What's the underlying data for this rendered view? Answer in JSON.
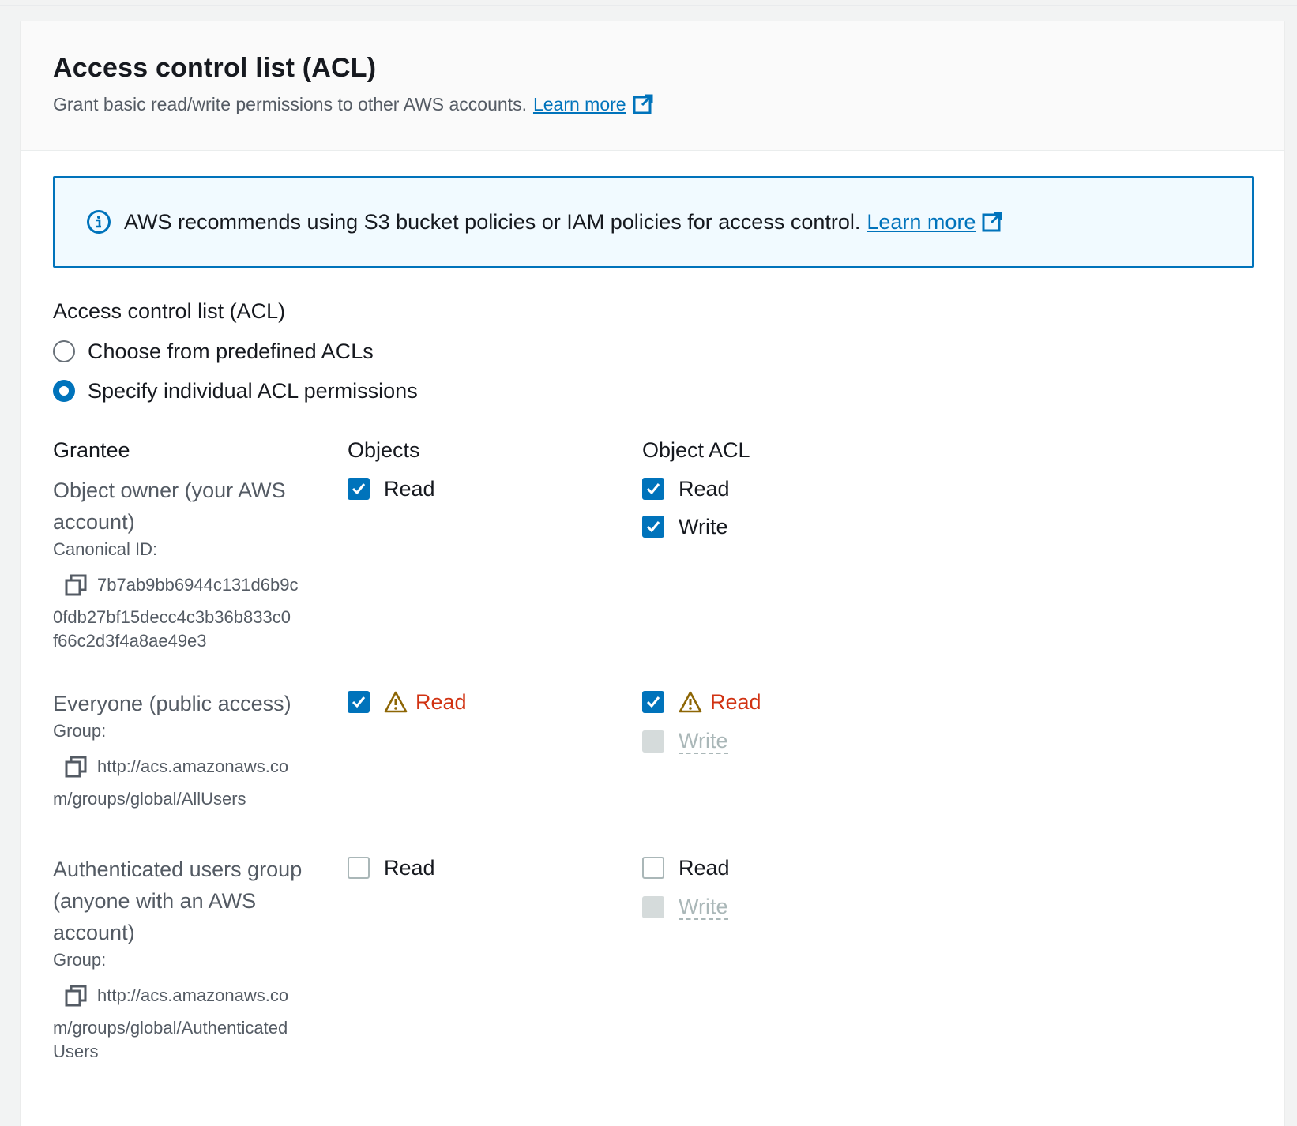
{
  "panel": {
    "title": "Access control list (ACL)",
    "description": "Grant basic read/write permissions to other AWS accounts.",
    "learn_more": "Learn more"
  },
  "alert": {
    "message": "AWS recommends using S3 bucket policies or IAM policies for access control.",
    "learn_more": "Learn more"
  },
  "acl": {
    "label": "Access control list (ACL)",
    "options": [
      {
        "label": "Choose from predefined ACLs",
        "selected": false
      },
      {
        "label": "Specify individual ACL permissions",
        "selected": true
      }
    ]
  },
  "table": {
    "headers": {
      "grantee": "Grantee",
      "objects": "Objects",
      "object_acl": "Object ACL"
    },
    "rows": [
      {
        "name": "Object owner (your AWS account)",
        "id_label": "Canonical ID:",
        "id_line1": "7b7ab9bb6944c131d6b9c",
        "id_line2": "0fdb27bf15decc4c3b36b833c0",
        "id_line3": "f66c2d3f4a8ae49e3",
        "objects_read": "Read",
        "acl_read": "Read",
        "acl_write": "Write"
      },
      {
        "name": "Everyone (public access)",
        "id_label": "Group:",
        "id_line1": "http://acs.amazonaws.co",
        "id_line2": "m/groups/global/AllUsers",
        "objects_read": "Read",
        "acl_read": "Read",
        "acl_write": "Write"
      },
      {
        "name_line1": "Authenticated users group",
        "name_line2": "(anyone with an AWS",
        "name_line3": "account)",
        "id_label": "Group:",
        "id_line1": "http://acs.amazonaws.co",
        "id_line2": "m/groups/global/Authenticated",
        "id_line3": "Users",
        "objects_read": "Read",
        "acl_read": "Read",
        "acl_write": "Write"
      }
    ]
  },
  "colors": {
    "accent": "#0073bb",
    "warning_text": "#d13212",
    "warning_icon": "#8d6605",
    "disabled": "#aab7b8"
  },
  "icons": [
    "external-link-icon",
    "info-icon",
    "copy-icon",
    "warning-icon",
    "checkmark-icon"
  ]
}
